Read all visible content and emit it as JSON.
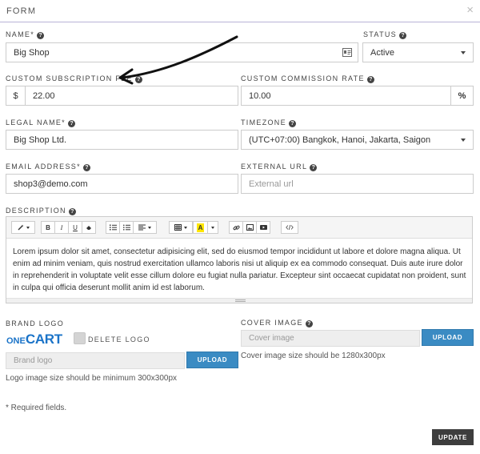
{
  "modal": {
    "title": "FORM",
    "close_label": "×"
  },
  "form": {
    "name": {
      "label": "NAME*",
      "value": "Big Shop"
    },
    "status": {
      "label": "STATUS",
      "value": "Active"
    },
    "custom_subscription_fee": {
      "label": "CUSTOM SUBSCRIPTION FEE",
      "prefix": "$",
      "value": "22.00"
    },
    "custom_commission_rate": {
      "label": "CUSTOM COMMISSION RATE",
      "value": "10.00",
      "suffix": "%"
    },
    "legal_name": {
      "label": "LEGAL NAME*",
      "value": "Big Shop Ltd."
    },
    "timezone": {
      "label": "TIMEZONE",
      "value": "(UTC+07:00) Bangkok, Hanoi, Jakarta, Saigon"
    },
    "email": {
      "label": "EMAIL ADDRESS*",
      "value": "shop3@demo.com"
    },
    "external_url": {
      "label": "EXTERNAL URL",
      "placeholder": "External url"
    },
    "description": {
      "label": "DESCRIPTION",
      "toolbar": {
        "bold": "B",
        "italic": "I",
        "underline": "U",
        "color_letter": "A"
      },
      "text": "Lorem ipsum dolor sit amet, consectetur adipisicing elit, sed do eiusmod tempor incididunt ut labore et dolore magna aliqua. Ut enim ad minim veniam, quis nostrud exercitation ullamco laboris nisi ut aliquip ex ea commodo consequat. Duis aute irure dolor in reprehenderit in voluptate velit esse cillum dolore eu fugiat nulla pariatur. Excepteur sint occaecat cupidatat non proident, sunt in culpa qui officia deserunt mollit anim id est laborum."
    },
    "brand_logo": {
      "label": "BRAND LOGO",
      "logo_prefix": "ONE",
      "logo_main": "CART",
      "delete_label": "DELETE LOGO",
      "file_placeholder": "Brand logo",
      "upload_label": "UPLOAD",
      "hint": "Logo image size should be minimum 300x300px"
    },
    "cover_image": {
      "label": "COVER IMAGE",
      "file_placeholder": "Cover image",
      "upload_label": "UPLOAD",
      "hint": "Cover image size should be 1280x300px"
    },
    "required_note": "* Required fields.",
    "submit_label": "UPDATE"
  },
  "colors": {
    "primary": "#3a8bc3",
    "dark_button": "#3d3d3d",
    "header_rule": "#b9b3d6",
    "logo": "#1a73c8"
  }
}
